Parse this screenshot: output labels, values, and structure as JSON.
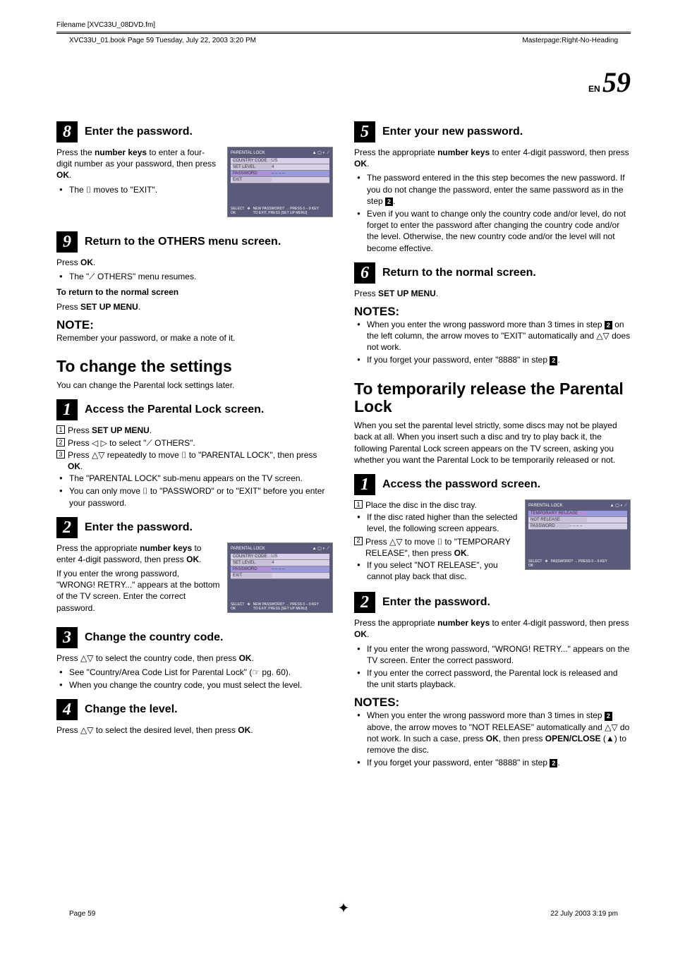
{
  "meta": {
    "filename_label": "Filename [XVC33U_08DVD.fm]",
    "book_info": "XVC33U_01.book  Page 59  Tuesday, July 22, 2003  3:20 PM",
    "masterpage": "Masterpage:Right-No-Heading",
    "en_label": "EN",
    "page_number": "59",
    "bottom_left": "Page 59",
    "bottom_right": "22 July 2003 3:19 pm"
  },
  "tv": {
    "title": "PARENTAL LOCK",
    "row1_label": "COUNTRY CODE",
    "row1_value": "US",
    "row2_label": "SET LEVEL",
    "row2_value": "4",
    "row3_label": "PASSWORD",
    "row3_value": "– – – –",
    "row4_label": "EXIT",
    "temp_label": "TEMPORARY RELEASE",
    "notrel_label": "NOT RELEASE",
    "footer_select": "SELECT",
    "footer_ok": "OK",
    "footer_hint1": "NEW PASSWORD? → PRESS 0 – 9 KEY",
    "footer_hint1b": "PASSWORD? → PRESS 0 – 9 KEY",
    "footer_hint2": "TO EXIT, PRESS [SET UP MENU]"
  },
  "left": {
    "s8": {
      "title": "Enter the password.",
      "p1a": "Press the ",
      "p1b": "number keys",
      "p1c": " to enter a four-digit number as your password, then press ",
      "p1d": "OK",
      "p1e": ".",
      "b1": "The ⌷ moves to \"EXIT\"."
    },
    "s9": {
      "title": "Return to the OTHERS menu screen.",
      "p1a": "Press ",
      "p1b": "OK",
      "p1c": ".",
      "b1": "The \"⟋ OTHERS\" menu resumes.",
      "p2": "To return to the normal screen",
      "p3a": "Press ",
      "p3b": "SET UP MENU",
      "p3c": "."
    },
    "note1_title": "NOTE:",
    "note1_text": "Remember your password, or make a note of it.",
    "change_title": "To change the settings",
    "change_intro": "You can change the Parental lock settings later.",
    "cs1": {
      "title": "Access the Parental Lock screen.",
      "l1a": "Press ",
      "l1b": "SET UP MENU",
      "l1c": ".",
      "l2": "Press ◁ ▷ to select \"⟋ OTHERS\".",
      "l3a": "Press △▽ repeatedly to move ⌷ to \"PARENTAL LOCK\", then press ",
      "l3b": "OK",
      "l3c": ".",
      "b1": "The \"PARENTAL LOCK\" sub-menu appears on the TV screen.",
      "b2": "You can only move ⌷ to \"PASSWORD\" or to \"EXIT\" before you enter your password."
    },
    "cs2": {
      "title": "Enter the password.",
      "p1a": "Press the appropriate ",
      "p1b": "number keys",
      "p1c": " to enter 4-digit password, then press ",
      "p1d": "OK",
      "p1e": ".",
      "p2": "If you enter the wrong password, \"WRONG! RETRY...\" appears at the bottom of the TV screen. Enter the correct password."
    },
    "cs3": {
      "title": "Change the country code.",
      "p1a": "Press △▽ to select the country code, then press ",
      "p1b": "OK",
      "p1c": ".",
      "b1": "See \"Country/Area Code List for Parental Lock\" (☞ pg. 60).",
      "b2": "When you change the country code, you must select the level."
    },
    "cs4": {
      "title": "Change the level.",
      "p1a": "Press △▽ to select the desired level, then press ",
      "p1b": "OK",
      "p1c": "."
    }
  },
  "right": {
    "s5": {
      "title": "Enter your new password.",
      "p1a": "Press the appropriate ",
      "p1b": "number keys",
      "p1c": " to enter 4-digit password, then press ",
      "p1d": "OK",
      "p1e": ".",
      "b1a": "The password entered in the this step becomes the new password. If you do not change the password, enter the same password as in the step ",
      "b1b": "2",
      "b1c": ".",
      "b2": "Even if you want to change only the country code and/or level, do not forget to enter the password after changing the country code and/or the level. Otherwise, the new country code and/or the level will not become effective."
    },
    "s6": {
      "title": "Return to the normal screen.",
      "p1a": "Press ",
      "p1b": "SET UP MENU",
      "p1c": "."
    },
    "notes1_title": "NOTES:",
    "notes1_b1a": "When you enter the wrong password more than 3 times in step ",
    "notes1_b1b": "2",
    "notes1_b1c": " on the left column, the arrow moves to \"EXIT\" automatically and △▽ does not work.",
    "notes1_b2a": "If you forget your password, enter \"8888\" in step ",
    "notes1_b2b": "2",
    "notes1_b2c": ".",
    "temp_title": "To temporarily release the Parental Lock",
    "temp_intro": "When you set the parental level strictly, some discs may not be played back at all. When you insert such a disc and try to play back it, the following Parental Lock screen appears on the TV screen, asking you whether you want the Parental Lock to be temporarily released or not.",
    "ts1": {
      "title": "Access the password screen.",
      "l1": "Place the disc in the disc tray.",
      "b1": "If the disc rated higher than the selected level, the following screen appears.",
      "l2a": "Press △▽ to move ⌷ to \"TEMPORARY RELEASE\", then press ",
      "l2b": "OK",
      "l2c": ".",
      "b2": "If you select \"NOT RELEASE\", you cannot play back that disc."
    },
    "ts2": {
      "title": "Enter the password.",
      "p1a": "Press the appropriate ",
      "p1b": "number keys",
      "p1c": " to enter 4-digit password, then press ",
      "p1d": "OK",
      "p1e": ".",
      "b1": "If you enter the wrong password, \"WRONG! RETRY...\" appears on the TV screen. Enter the correct password.",
      "b2": "If you enter the correct password, the Parental lock is released and the unit starts playback."
    },
    "notes2_title": "NOTES:",
    "notes2_b1a": "When you enter the wrong password more than 3 times in step ",
    "notes2_b1b": "2",
    "notes2_b1c": " above, the arrow moves to \"NOT RELEASE\" automatically and △▽ do not work. In such a case, press ",
    "notes2_b1d": "OK",
    "notes2_b1e": ", then press ",
    "notes2_b1f": "OPEN/CLOSE",
    "notes2_b1g": " (▲) to remove the disc.",
    "notes2_b2a": "If you forget your password, enter \"8888\" in step ",
    "notes2_b2b": "2",
    "notes2_b2c": "."
  }
}
